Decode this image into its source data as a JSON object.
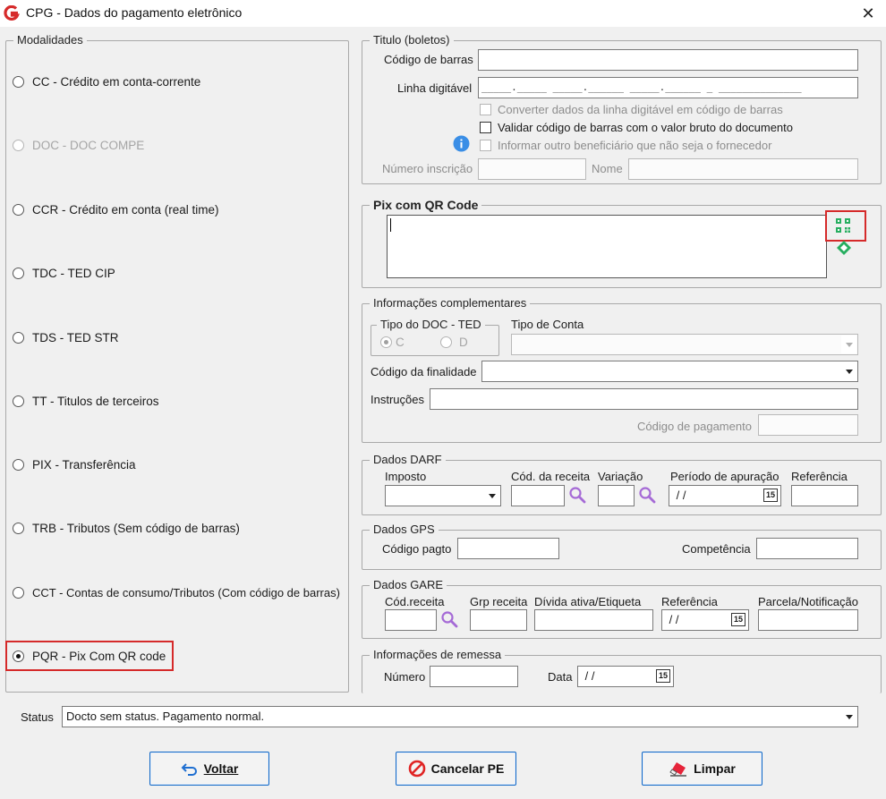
{
  "window": {
    "title": "CPG - Dados do pagamento eletrônico"
  },
  "modalidades": {
    "legend": "Modalidades",
    "options": [
      {
        "label": "CC  - Crédito em conta-corrente"
      },
      {
        "label": "DOC - DOC COMPE"
      },
      {
        "label": "CCR - Crédito em conta (real time)"
      },
      {
        "label": "TDC - TED CIP"
      },
      {
        "label": "TDS - TED STR"
      },
      {
        "label": "TT  - Titulos de terceiros"
      },
      {
        "label": "PIX - Transferência"
      },
      {
        "label": "TRB - Tributos (Sem código de barras)"
      },
      {
        "label": "CCT - Contas de consumo/Tributos (Com código de barras)"
      },
      {
        "label": "PQR - Pix Com QR code"
      }
    ]
  },
  "titulo": {
    "legend": "Titulo (boletos)",
    "codigo_barras_label": "Código de barras",
    "linha_digitavel_label": "Linha digitável",
    "linha_digitavel_mask": "_____._____ _____.______ _____.______ _ ______________",
    "converter_label": "Converter dados da linha digitável em código de barras",
    "validar_label": "Validar código de barras com o valor bruto do documento",
    "informar_label": "Informar outro beneficiário que não seja o fornecedor",
    "numero_inscricao_label": "Número inscrição",
    "nome_label": "Nome"
  },
  "pix": {
    "legend": "Pix com QR Code"
  },
  "info_comp": {
    "legend": "Informações complementares",
    "tipo_doc_legend": "Tipo do DOC - TED",
    "radio_c": "C",
    "radio_d": "D",
    "tipo_conta_label": "Tipo de Conta",
    "codigo_finalidade_label": "Código da finalidade",
    "instrucoes_label": "Instruções",
    "codigo_pagamento_label": "Código de pagamento"
  },
  "darf": {
    "legend": "Dados DARF",
    "imposto_label": "Imposto",
    "cod_receita_label": "Cód. da receita",
    "variacao_label": "Variação",
    "periodo_label": "Período de apuração",
    "referencia_label": "Referência",
    "periodo_value": " / /"
  },
  "gps": {
    "legend": "Dados GPS",
    "codigo_pagto_label": "Código pagto",
    "competencia_label": "Competência"
  },
  "gare": {
    "legend": "Dados GARE",
    "cod_receita_label": "Cód.receita",
    "grp_receita_label": "Grp receita",
    "divida_label": "Dívida ativa/Etiqueta",
    "referencia_label": "Referência",
    "parcela_label": "Parcela/Notificação",
    "referencia_value": " / /"
  },
  "remessa": {
    "legend": "Informações de remessa",
    "numero_label": "Número",
    "data_label": "Data",
    "data_value": " / /"
  },
  "status": {
    "label": "Status",
    "value": "Docto sem status. Pagamento normal."
  },
  "calendar_icon_text": "15",
  "buttons": {
    "voltar": "Voltar",
    "cancelar": "Cancelar PE",
    "limpar": "Limpar"
  },
  "colors": {
    "accent": "#0f67c6",
    "highlight": "#d52a2a",
    "brand": "#d62b2b",
    "qr": "#27ae60",
    "search": "#a56ad6"
  }
}
